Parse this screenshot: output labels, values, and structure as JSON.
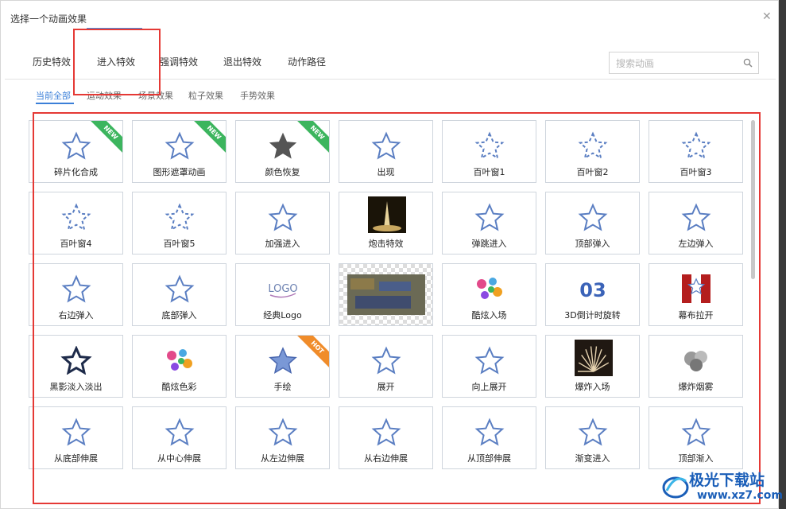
{
  "dialog": {
    "title": "选择一个动画效果"
  },
  "tabs": [
    {
      "label": "历史特效"
    },
    {
      "label": "进入特效"
    },
    {
      "label": "强调特效"
    },
    {
      "label": "退出特效"
    },
    {
      "label": "动作路径"
    }
  ],
  "active_tab": "进入特效",
  "search": {
    "placeholder": "搜索动画"
  },
  "subtabs": [
    {
      "label": "当前全部"
    },
    {
      "label": "运动效果"
    },
    {
      "label": "场景效果"
    },
    {
      "label": "粒子效果"
    },
    {
      "label": "手势效果"
    }
  ],
  "active_subtab": "当前全部",
  "effects": [
    {
      "label": "碎片化合成",
      "badge": "NEW"
    },
    {
      "label": "图形遮罩动画",
      "badge": "NEW"
    },
    {
      "label": "颜色恢复",
      "badge": "NEW"
    },
    {
      "label": "出现"
    },
    {
      "label": "百叶窗1"
    },
    {
      "label": "百叶窗2"
    },
    {
      "label": "百叶窗3"
    },
    {
      "label": "百叶窗4"
    },
    {
      "label": "百叶窗5"
    },
    {
      "label": "加强进入"
    },
    {
      "label": "炮击特效"
    },
    {
      "label": "弹跳进入"
    },
    {
      "label": "顶部弹入"
    },
    {
      "label": "左边弹入"
    },
    {
      "label": "右边弹入"
    },
    {
      "label": "底部弹入"
    },
    {
      "label": "经典Logo"
    },
    {
      "label": ""
    },
    {
      "label": "酷炫入场"
    },
    {
      "label": "3D倒计时旋转"
    },
    {
      "label": "幕布拉开"
    },
    {
      "label": "黑影淡入淡出"
    },
    {
      "label": "酷炫色彩"
    },
    {
      "label": "手绘",
      "badge": "HOT"
    },
    {
      "label": "展开"
    },
    {
      "label": "向上展开"
    },
    {
      "label": "爆炸入场"
    },
    {
      "label": "爆炸烟雾"
    },
    {
      "label": "从底部伸展"
    },
    {
      "label": "从中心伸展"
    },
    {
      "label": "从左边伸展"
    },
    {
      "label": "从右边伸展"
    },
    {
      "label": "从顶部伸展"
    },
    {
      "label": "渐变进入"
    },
    {
      "label": "顶部渐入"
    }
  ],
  "watermark": {
    "text": "极光下载站",
    "url": "www.xz7.com"
  },
  "colors": {
    "accent": "#3b7fd8",
    "star": "#5a7ec2",
    "highlight": "#e53935",
    "badge_new": "#3cb55e",
    "badge_hot": "#f08c2a"
  }
}
